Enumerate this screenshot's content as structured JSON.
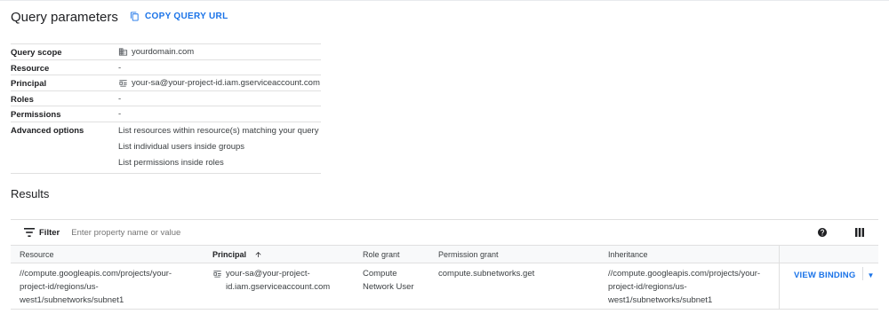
{
  "query_parameters": {
    "title": "Query parameters",
    "copy_url_label": "COPY QUERY URL",
    "rows": {
      "scope_label": "Query scope",
      "scope_value": "yourdomain.com",
      "resource_label": "Resource",
      "resource_value": "-",
      "principal_label": "Principal",
      "principal_value": "your-sa@your-project-id.iam.gserviceaccount.com",
      "roles_label": "Roles",
      "roles_value": "-",
      "permissions_label": "Permissions",
      "permissions_value": "-",
      "advanced_label": "Advanced options",
      "advanced_values": [
        "List resources within resource(s) matching your query",
        "List individual users inside groups",
        "List permissions inside roles"
      ]
    }
  },
  "results": {
    "title": "Results",
    "filter_label": "Filter",
    "filter_placeholder": "Enter property name or value",
    "columns": {
      "resource": "Resource",
      "principal": "Principal",
      "role_grant": "Role grant",
      "permission_grant": "Permission grant",
      "inheritance": "Inheritance"
    },
    "sorted_column": "principal",
    "sort_direction": "ascending",
    "rows": [
      {
        "resource": "//compute.googleapis.com/projects/your-\nproject-id/regions/us-\nwest1/subnetworks/subnet1",
        "principal": "your-sa@your-project-\nid.iam.gserviceaccount.com",
        "role_grant": "Compute\nNetwork User",
        "permission_grant": "compute.subnetworks.get",
        "inheritance": "//compute.googleapis.com/projects/your-\nproject-id/regions/us-\nwest1/subnetworks/subnet1",
        "action_label": "VIEW BINDING"
      }
    ]
  },
  "icons": {
    "copy": "copy-icon",
    "domain": "domain-building-icon",
    "service_account": "service-account-icon",
    "filter": "filter-icon",
    "help": "help-icon",
    "columns": "column-display-icon",
    "sort": "arrow-upward-icon",
    "dropdown": "dropdown-arrow-icon"
  },
  "colors": {
    "accent": "#1a73e8",
    "text": "#202124",
    "muted": "#5f6368",
    "divider": "#e0e0e0",
    "header_bg": "#f8f9fa"
  }
}
